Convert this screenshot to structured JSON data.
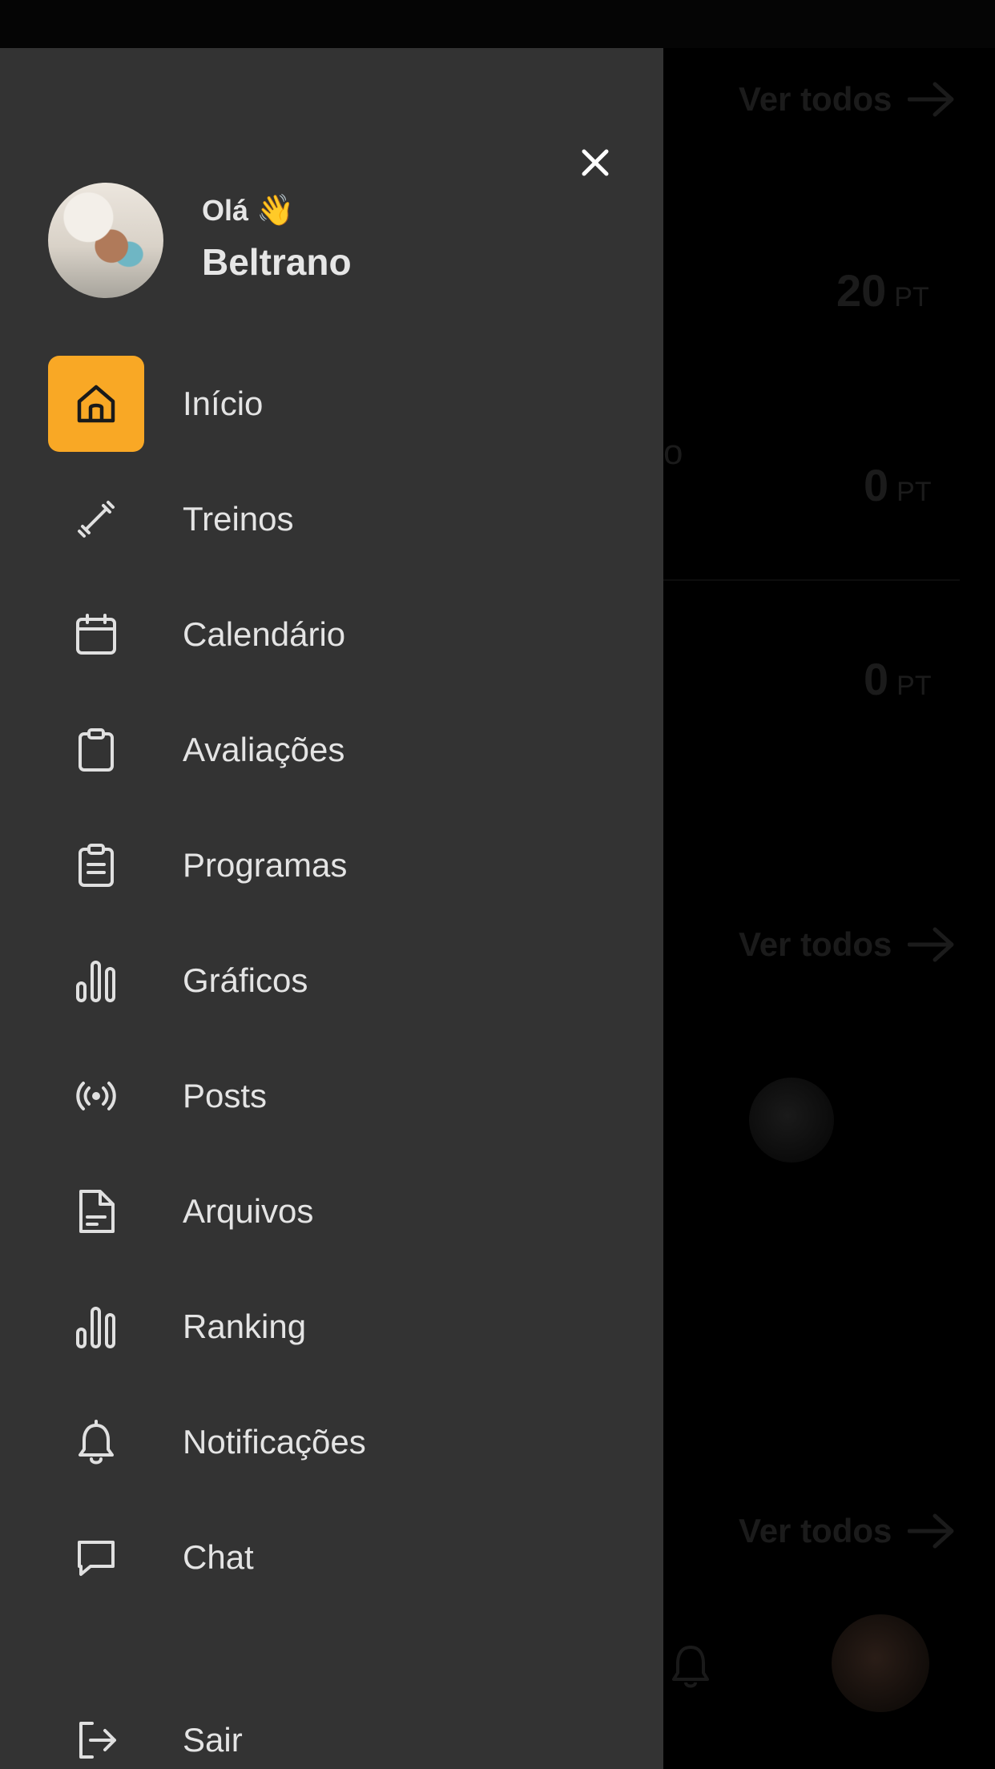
{
  "background": {
    "see_all_label": "Ver todos",
    "points": [
      {
        "value": "20",
        "unit": "PT"
      },
      {
        "value": "0",
        "unit": "PT"
      },
      {
        "value": "0",
        "unit": "PT"
      }
    ],
    "partial_text": "o"
  },
  "drawer": {
    "greeting": "Olá",
    "wave_emoji": "👋",
    "username": "Beltrano",
    "accent_color": "#f9a825",
    "items": [
      {
        "label": "Início",
        "icon": "home-icon",
        "active": true
      },
      {
        "label": "Treinos",
        "icon": "dumbbell-icon",
        "active": false
      },
      {
        "label": "Calendário",
        "icon": "calendar-icon",
        "active": false
      },
      {
        "label": "Avaliações",
        "icon": "clipboard-icon",
        "active": false
      },
      {
        "label": "Programas",
        "icon": "clipboard-list-icon",
        "active": false
      },
      {
        "label": "Gráficos",
        "icon": "bar-chart-icon",
        "active": false
      },
      {
        "label": "Posts",
        "icon": "broadcast-icon",
        "active": false
      },
      {
        "label": "Arquivos",
        "icon": "file-icon",
        "active": false
      },
      {
        "label": "Ranking",
        "icon": "bar-chart-icon",
        "active": false
      },
      {
        "label": "Notificações",
        "icon": "bell-icon",
        "active": false
      },
      {
        "label": "Chat",
        "icon": "chat-icon",
        "active": false
      }
    ],
    "logout": {
      "label": "Sair",
      "icon": "logout-icon"
    }
  }
}
